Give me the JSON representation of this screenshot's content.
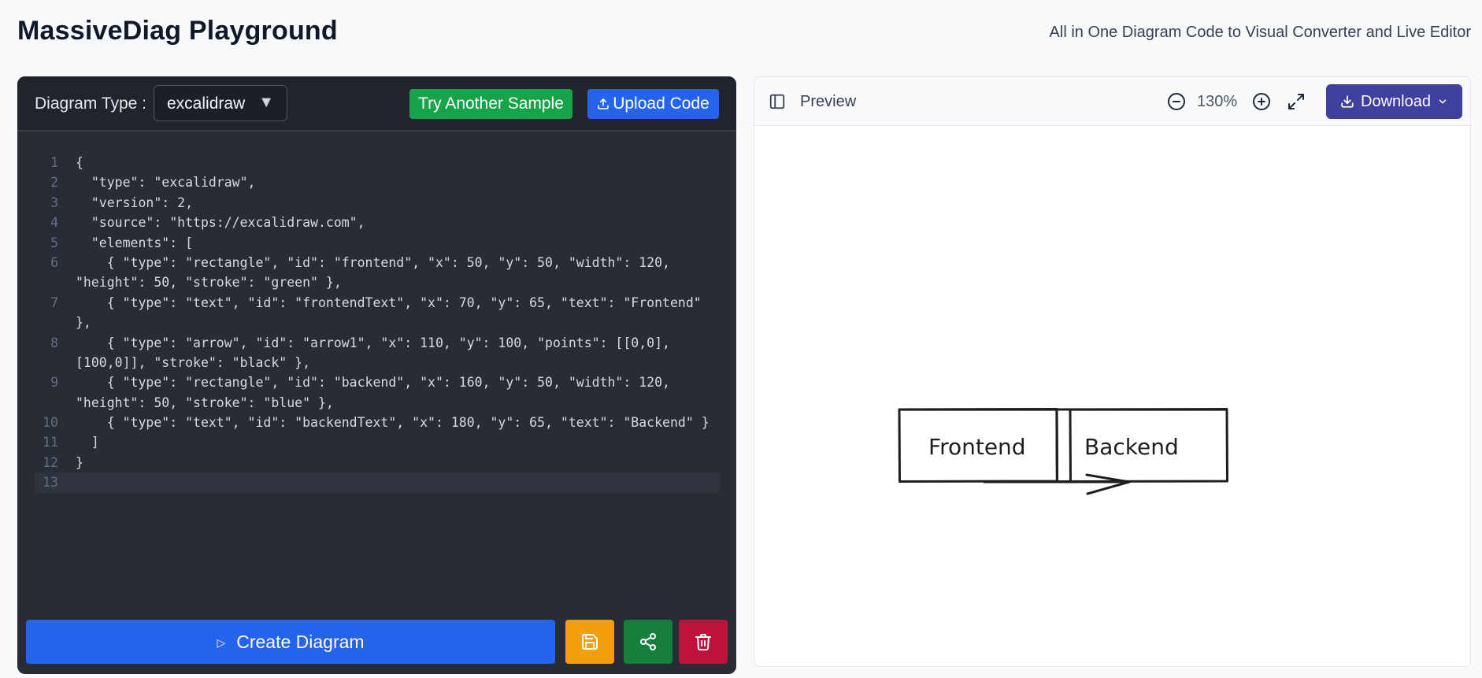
{
  "header": {
    "title": "MassiveDiag Playground",
    "subtitle": "All in One Diagram Code to Visual Converter and Live Editor"
  },
  "editor": {
    "type_label": "Diagram Type :",
    "type_value": "excalidraw",
    "sample_button": "Try Another Sample",
    "upload_button": "Upload Code",
    "create_button": "Create Diagram",
    "lines": [
      {
        "n": "1",
        "text": "{"
      },
      {
        "n": "2",
        "text": "  \"type\": \"excalidraw\","
      },
      {
        "n": "3",
        "text": "  \"version\": 2,"
      },
      {
        "n": "4",
        "text": "  \"source\": \"https://excalidraw.com\","
      },
      {
        "n": "5",
        "text": "  \"elements\": ["
      },
      {
        "n": "6",
        "text": "    { \"type\": \"rectangle\", \"id\": \"frontend\", \"x\": 50, \"y\": 50, \"width\": 120,"
      },
      {
        "n": "",
        "text": "\"height\": 50, \"stroke\": \"green\" },"
      },
      {
        "n": "7",
        "text": "    { \"type\": \"text\", \"id\": \"frontendText\", \"x\": 70, \"y\": 65, \"text\": \"Frontend\""
      },
      {
        "n": "",
        "text": "},"
      },
      {
        "n": "8",
        "text": "    { \"type\": \"arrow\", \"id\": \"arrow1\", \"x\": 110, \"y\": 100, \"points\": [[0,0],"
      },
      {
        "n": "",
        "text": "[100,0]], \"stroke\": \"black\" },"
      },
      {
        "n": "9",
        "text": "    { \"type\": \"rectangle\", \"id\": \"backend\", \"x\": 160, \"y\": 50, \"width\": 120,"
      },
      {
        "n": "",
        "text": "\"height\": 50, \"stroke\": \"blue\" },"
      },
      {
        "n": "10",
        "text": "    { \"type\": \"text\", \"id\": \"backendText\", \"x\": 180, \"y\": 65, \"text\": \"Backend\" }"
      },
      {
        "n": "11",
        "text": "  ]"
      },
      {
        "n": "12",
        "text": "}"
      },
      {
        "n": "13",
        "text": ""
      }
    ]
  },
  "preview": {
    "title": "Preview",
    "zoom": "130%",
    "download_button": "Download",
    "diagram": {
      "frontend_label": "Frontend",
      "backend_label": "Backend"
    }
  },
  "colors": {
    "editor_bg": "#282c34",
    "primary": "#2563eb",
    "success": "#16a34a",
    "warning": "#f59e0b",
    "share": "#15803d",
    "danger": "#be123c",
    "download": "#3f3f9e"
  },
  "icons": [
    "upload-icon",
    "play-icon",
    "save-icon",
    "share-icon",
    "trash-icon",
    "sidebar-toggle-icon",
    "zoom-out-icon",
    "zoom-in-icon",
    "fullscreen-icon",
    "download-icon",
    "chevron-down-icon"
  ]
}
